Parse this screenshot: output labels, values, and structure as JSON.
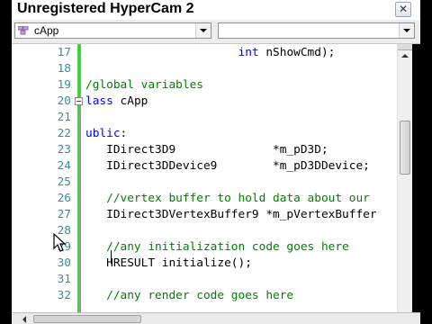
{
  "watermark": {
    "text": "Unregistered HyperCam 2"
  },
  "window": {
    "close_glyph": "✕",
    "close_icon": "close-icon"
  },
  "navbar": {
    "class_dropdown": {
      "value": "cApp",
      "icon": "class-icon"
    },
    "member_dropdown": {
      "value": ""
    }
  },
  "colors": {
    "keyword": "#0000ff",
    "comment": "#008000",
    "line_number": "#2b91af",
    "change_bar": "#40d040"
  },
  "editor": {
    "lines": [
      {
        "num": "17",
        "segments": [
          {
            "t": "                      ",
            "c": ""
          },
          {
            "t": "int",
            "c": "kw"
          },
          {
            "t": " nShowCmd);",
            "c": ""
          }
        ]
      },
      {
        "num": "18",
        "segments": []
      },
      {
        "num": "19",
        "segments": [
          {
            "t": "/global variables",
            "c": "cm"
          }
        ]
      },
      {
        "num": "20",
        "segments": [
          {
            "t": "lass",
            "c": "kw"
          },
          {
            "t": " cApp",
            "c": ""
          }
        ]
      },
      {
        "num": "21",
        "segments": []
      },
      {
        "num": "22",
        "segments": [
          {
            "t": "ublic",
            "c": "kw"
          },
          {
            "t": ":",
            "c": ""
          }
        ]
      },
      {
        "num": "23",
        "segments": [
          {
            "t": "   IDirect3D9              *m_pD3D;",
            "c": ""
          }
        ]
      },
      {
        "num": "24",
        "segments": [
          {
            "t": "   IDirect3DDevice9        *m_pD3DDevice;",
            "c": ""
          }
        ]
      },
      {
        "num": "25",
        "segments": []
      },
      {
        "num": "26",
        "segments": [
          {
            "t": "   //vertex buffer to hold data about our",
            "c": "cm"
          }
        ]
      },
      {
        "num": "27",
        "segments": [
          {
            "t": "   IDirect3DVertexBuffer9 *m_pVertexBuffer",
            "c": ""
          }
        ]
      },
      {
        "num": "28",
        "segments": []
      },
      {
        "num": "29",
        "segments": [
          {
            "t": "   //any initialization code goes here",
            "c": "cm"
          }
        ]
      },
      {
        "num": "30",
        "segments": [
          {
            "t": "   HRESULT initialize();",
            "c": ""
          }
        ]
      },
      {
        "num": "31",
        "segments": []
      },
      {
        "num": "32",
        "segments": [
          {
            "t": "   //any render code goes here",
            "c": "cm"
          }
        ]
      }
    ]
  },
  "scrollbar": {
    "vertical_position": 0.3
  }
}
